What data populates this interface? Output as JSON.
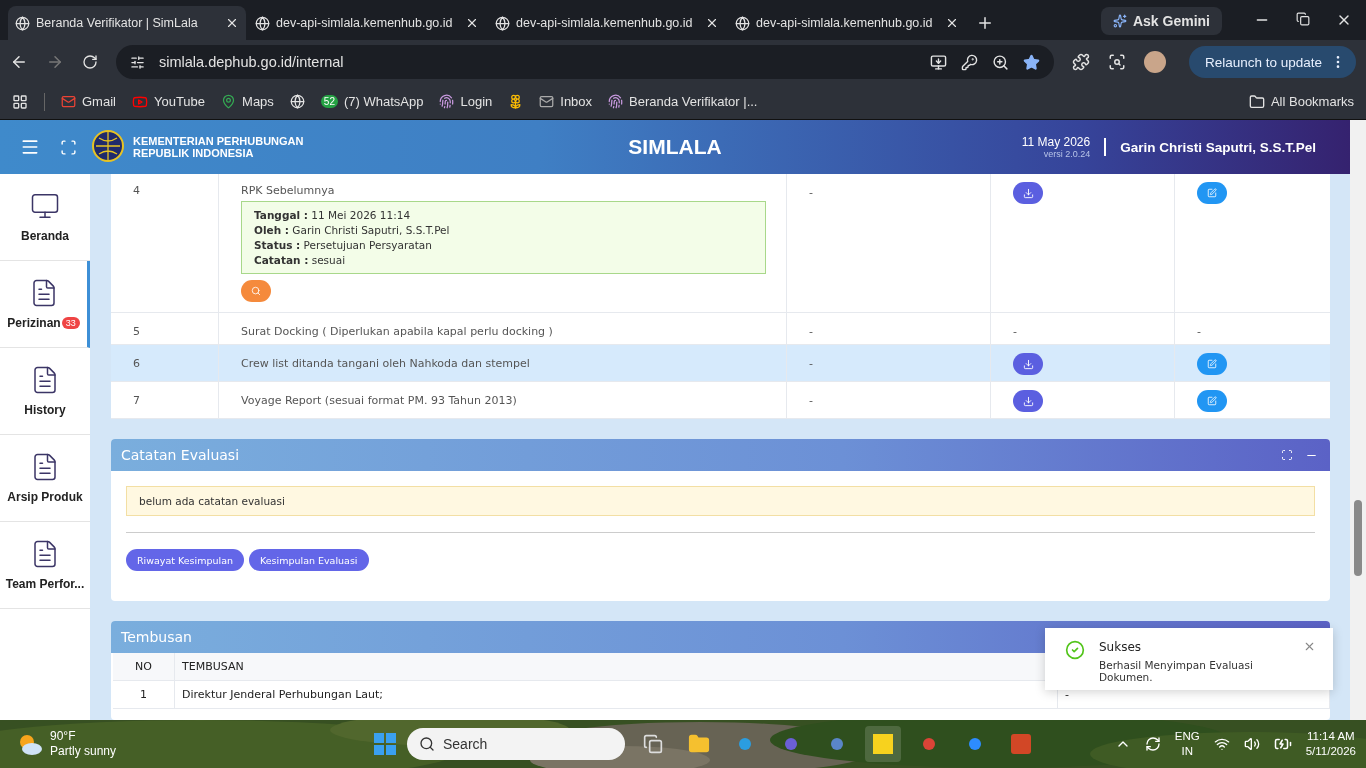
{
  "browser": {
    "tabs": [
      {
        "title": "Beranda Verifikator | SimLala",
        "selected": true
      },
      {
        "title": "dev-api-simlala.kemenhub.go.id",
        "selected": false
      },
      {
        "title": "dev-api-simlala.kemenhub.go.id",
        "selected": false
      },
      {
        "title": "dev-api-simlala.kemenhub.go.id",
        "selected": false
      }
    ],
    "gemini": "Ask Gemini",
    "address": "simlala.dephub.go.id/internal",
    "relaunch": "Relaunch to update",
    "bookmarks": [
      {
        "kind": "link",
        "label": "Gmail"
      },
      {
        "kind": "link",
        "label": "YouTube"
      },
      {
        "kind": "link",
        "label": "Maps"
      },
      {
        "kind": "icon"
      },
      {
        "kind": "link",
        "label": "(7) WhatsApp",
        "badge": "52"
      },
      {
        "kind": "link",
        "label": "Login"
      },
      {
        "kind": "icon"
      },
      {
        "kind": "link",
        "label": "Inbox"
      },
      {
        "kind": "link",
        "label": "Beranda Verifikator |..."
      }
    ],
    "all_bookmarks": "All Bookmarks"
  },
  "header": {
    "org_line_1": "KEMENTERIAN PERHUBUNGAN",
    "org_line_2": "REPUBLIK INDONESIA",
    "title": "SIMLALA",
    "date": "11 May 2026",
    "version": "versi 2.0.24",
    "user": "Garin Christi Saputri, S.S.T.Pel"
  },
  "sidebar": {
    "items": [
      {
        "label": "Beranda",
        "selected": false
      },
      {
        "label": "Perizinan",
        "badge": "33",
        "selected": true
      },
      {
        "label": "History",
        "selected": false
      },
      {
        "label": "Arsip Produk",
        "selected": false
      },
      {
        "label": "Team Perfor...",
        "selected": false
      }
    ]
  },
  "documents": {
    "rows": [
      {
        "no": "4",
        "name": "RPK Sebelumnya",
        "highlighted": false,
        "info": [
          {
            "label": "Tanggal :",
            "value": "11 Mei 2026 11:14"
          },
          {
            "label": "Oleh :",
            "value": "Garin Christi Saputri, S.S.T.Pel"
          },
          {
            "label": "Status :",
            "value": "Persetujuan Persyaratan"
          },
          {
            "label": "Catatan :",
            "value": "sesuai"
          }
        ],
        "cells": [
          {
            "kind": "text",
            "text": "-"
          },
          {
            "kind": "download"
          },
          {
            "kind": "edit"
          }
        ]
      },
      {
        "no": "5",
        "name": "Surat Docking ( Diperlukan apabila kapal perlu docking )",
        "highlighted": false,
        "cells": [
          {
            "kind": "text",
            "text": "-"
          },
          {
            "kind": "text",
            "text": "-"
          },
          {
            "kind": "text",
            "text": "-"
          }
        ]
      },
      {
        "no": "6",
        "name": "Crew list ditanda tangani oleh Nahkoda dan stempel",
        "highlighted": true,
        "cells": [
          {
            "kind": "text",
            "text": "-"
          },
          {
            "kind": "download"
          },
          {
            "kind": "edit"
          }
        ]
      },
      {
        "no": "7",
        "name": "Voyage Report (sesuai format PM. 93 Tahun 2013)",
        "highlighted": false,
        "cells": [
          {
            "kind": "text",
            "text": "-"
          },
          {
            "kind": "download"
          },
          {
            "kind": "edit"
          }
        ]
      }
    ]
  },
  "evaluation": {
    "title": "Catatan Evaluasi",
    "note": "belum ada catatan evaluasi",
    "buttons": [
      "Riwayat Kesimpulan",
      "Kesimpulan Evaluasi"
    ]
  },
  "tembusan": {
    "title": "Tembusan",
    "columns": [
      "NO",
      "TEMBUSAN"
    ],
    "rows": [
      {
        "no": "1",
        "name": "Direktur Jenderal Perhubungan Laut;",
        "column_3": "-"
      }
    ]
  },
  "toast": {
    "title": "Sukses",
    "message": "Berhasil Menyimpan Evaluasi Dokumen."
  },
  "taskbar": {
    "temperature": "90°F",
    "weather": "Partly sunny",
    "search_placeholder": "Search",
    "language_1": "ENG",
    "language_2": "IN",
    "time": "11:14 AM",
    "date": "5/11/2026"
  }
}
